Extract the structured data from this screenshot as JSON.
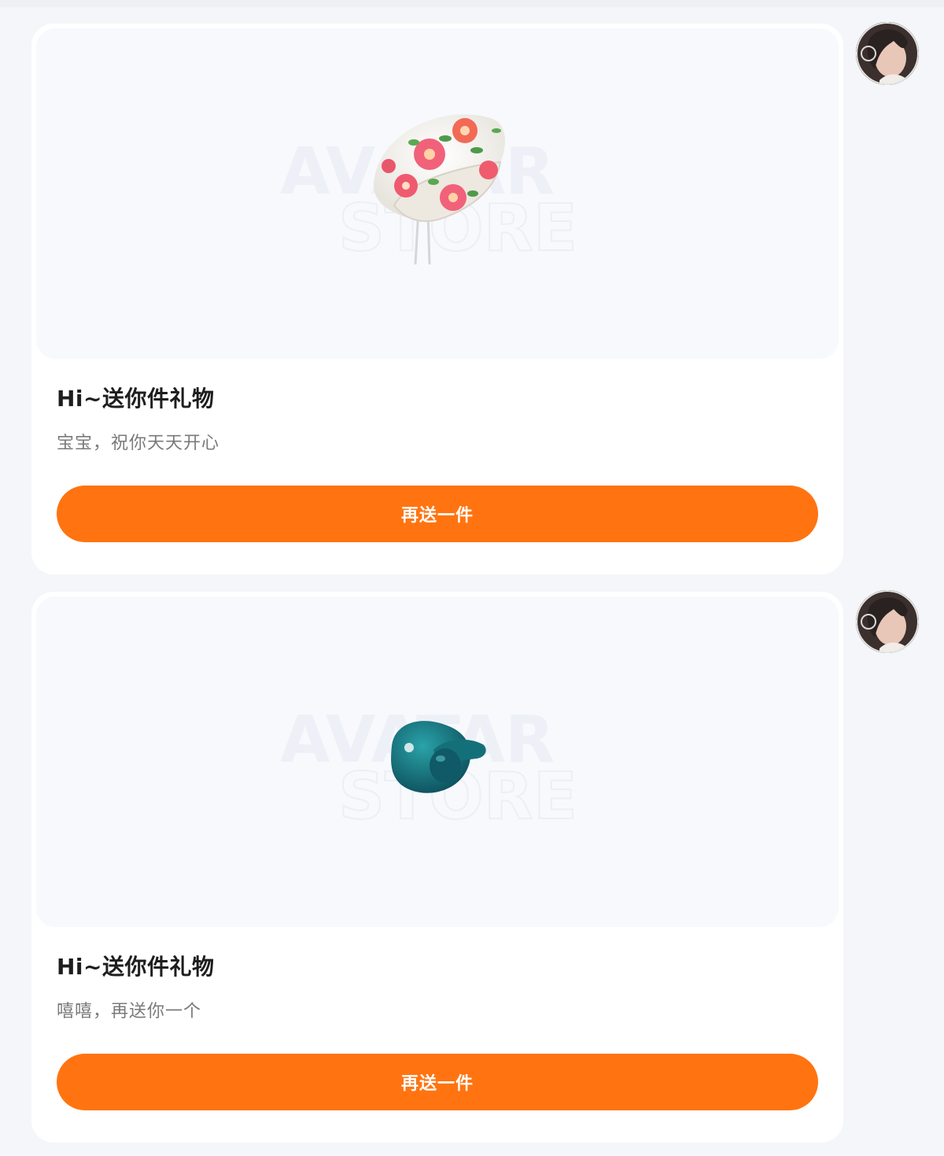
{
  "colors": {
    "page_bg": "#f4f6f9",
    "card_bg": "#ffffff",
    "preview_bg": "#f7f9fc",
    "accent": "#ff7410",
    "title_text": "#1e1e1e",
    "subtitle_text": "#7a7a7a"
  },
  "messages": [
    {
      "item_icon": "floral-headscarf",
      "watermark": [
        "AVATAR",
        "STORE"
      ],
      "title": "Hi~送你件礼物",
      "note": "宝宝，祝你天天开心",
      "button_label": "再送一件",
      "avatar_icon": "sender-avatar"
    },
    {
      "item_icon": "teal-pacifier",
      "watermark": [
        "AVATAR",
        "STORE"
      ],
      "title": "Hi~送你件礼物",
      "note": "嘻嘻，再送你一个",
      "button_label": "再送一件",
      "avatar_icon": "sender-avatar"
    }
  ]
}
